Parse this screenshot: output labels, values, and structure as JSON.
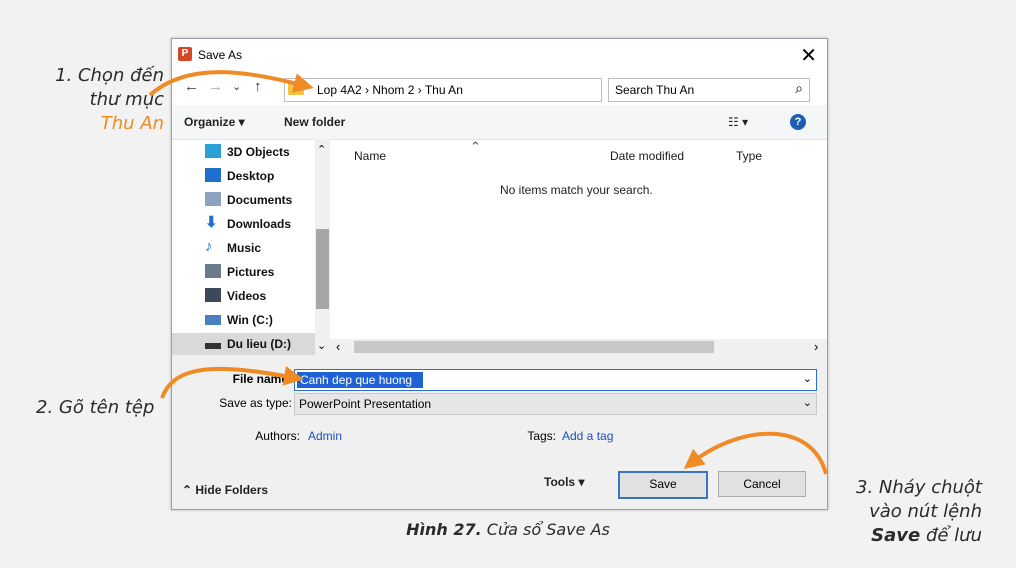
{
  "annotations": {
    "step1": {
      "line1": "1. Chọn đến",
      "line2": "thư mục",
      "line3": "Thu An"
    },
    "step2": {
      "text": "2. Gõ tên tệp"
    },
    "step3": {
      "line1": "3. Nháy chuột",
      "line2": "vào nút lệnh",
      "bold": "Save",
      "rest": " để lưu"
    }
  },
  "dialog": {
    "title": "Save As",
    "close": "✕",
    "nav": {
      "back": "←",
      "forward": "→",
      "recent": "⌄",
      "up": "↑"
    },
    "address": {
      "breadcrumb": "Lop 4A2  ›  Nhom 2  ›  Thu An",
      "refresh": "↻",
      "dropdown": "⌄"
    },
    "search": {
      "placeholder": "Search Thu An",
      "icon": "⌕"
    },
    "toolbar": {
      "organize": "Organize ▾",
      "new_folder": "New folder",
      "view": "☷ ▾",
      "help": "?"
    },
    "nav_pane": {
      "items": [
        {
          "label": "3D Objects",
          "icon": "cube-icon",
          "color": "#2aa0d8"
        },
        {
          "label": "Desktop",
          "icon": "desktop-icon",
          "color": "#1f6fd1"
        },
        {
          "label": "Documents",
          "icon": "document-icon",
          "color": "#8aa4bf"
        },
        {
          "label": "Downloads",
          "icon": "download-icon",
          "color": "#1f6fd1"
        },
        {
          "label": "Music",
          "icon": "music-icon",
          "color": "#1f6fd1"
        },
        {
          "label": "Pictures",
          "icon": "pictures-icon",
          "color": "#6b7b8c"
        },
        {
          "label": "Videos",
          "icon": "videos-icon",
          "color": "#3a4a5a"
        },
        {
          "label": "Win (C:)",
          "icon": "drive-icon",
          "color": "#4a7fc1"
        },
        {
          "label": "Du lieu (D:)",
          "icon": "drive-icon",
          "color": "#333333"
        }
      ],
      "scroll_up": "⌃",
      "scroll_down": "⌄"
    },
    "file_list": {
      "columns": [
        "Name",
        "Date modified",
        "Type"
      ],
      "empty_message": "No items match your search.",
      "scroll_left": "‹",
      "scroll_right": "›",
      "sort": "⌃"
    },
    "form": {
      "file_name_label": "File name:",
      "file_name_value": "Canh dep que huong",
      "save_type_label": "Save as type:",
      "save_type_value": "PowerPoint Presentation",
      "authors_label": "Authors:",
      "authors_value": "Admin",
      "tags_label": "Tags:",
      "tags_value": "Add a tag"
    },
    "footer": {
      "hide_folders": "⌃  Hide Folders",
      "tools": "Tools   ▾",
      "save": "Save",
      "cancel": "Cancel"
    }
  },
  "caption": {
    "bold": "Hình 27.",
    "rest": " Cửa sổ Save As"
  },
  "colors": {
    "accent": "#f08a24",
    "selection": "#1f62d6",
    "link": "#1d4fb5"
  }
}
